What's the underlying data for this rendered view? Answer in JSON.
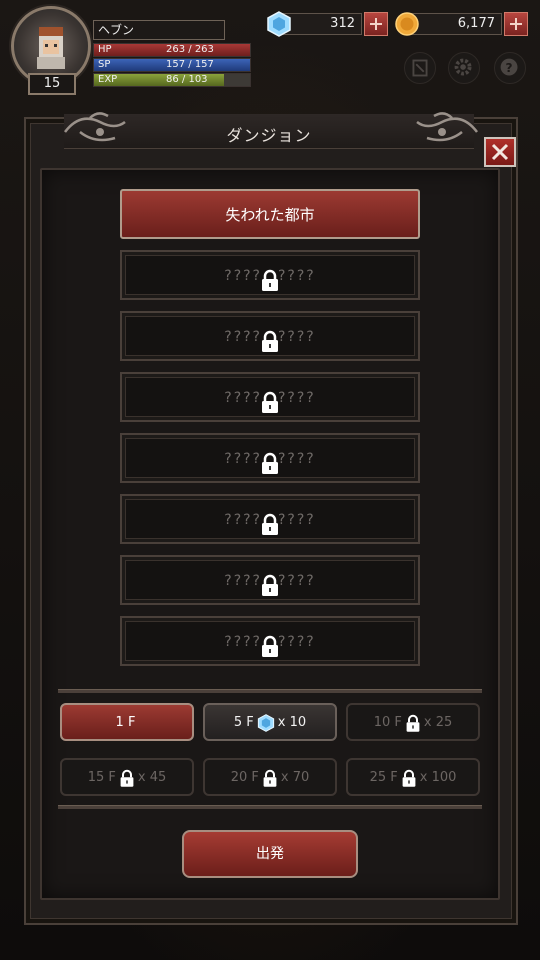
{
  "player": {
    "name": "ヘブン",
    "level": "15",
    "hp_label": "HP",
    "hp_value": "263 / 263",
    "hp_fraction": 1.0,
    "sp_label": "SP",
    "sp_value": "157 / 157",
    "sp_fraction": 1.0,
    "exp_label": "EXP",
    "exp_value": "86 / 103",
    "exp_fraction": 0.835
  },
  "currency": {
    "gems": "312",
    "gold": "6,177"
  },
  "icons": {
    "gem": "gem-icon",
    "gold": "gold-coin-icon",
    "book": "book-icon",
    "settings": "gear-icon",
    "help": "help-icon",
    "close": "close-icon",
    "lock": "lock-icon"
  },
  "colors": {
    "accent_red": "#8a2c26",
    "gem_blue": "#7fc8f0",
    "gold": "#e8a23a",
    "hp": "#a83836",
    "sp": "#3c64b8",
    "exp": "#8aa23b"
  },
  "panel": {
    "title": "ダンジョン"
  },
  "dungeons": [
    {
      "label": "失われた都市",
      "locked": false
    },
    {
      "label_left": "????",
      "label_right": "????",
      "locked": true
    },
    {
      "label_left": "????",
      "label_right": "????",
      "locked": true
    },
    {
      "label_left": "????",
      "label_right": "????",
      "locked": true
    },
    {
      "label_left": "????",
      "label_right": "????",
      "locked": true
    },
    {
      "label_left": "????",
      "label_right": "????",
      "locked": true
    },
    {
      "label_left": "????",
      "label_right": "????",
      "locked": true
    },
    {
      "label_left": "????",
      "label_right": "????",
      "locked": true
    }
  ],
  "floors": [
    {
      "floor": "1 F",
      "cost": "",
      "state": "active"
    },
    {
      "floor": "5 F",
      "cost": "x 10",
      "state": "unlocked"
    },
    {
      "floor": "10 F",
      "cost": "x 25",
      "state": "locked"
    },
    {
      "floor": "15 F",
      "cost": "x 45",
      "state": "locked"
    },
    {
      "floor": "20 F",
      "cost": "x 70",
      "state": "locked"
    },
    {
      "floor": "25 F",
      "cost": "x 100",
      "state": "locked"
    }
  ],
  "depart_label": "出発"
}
